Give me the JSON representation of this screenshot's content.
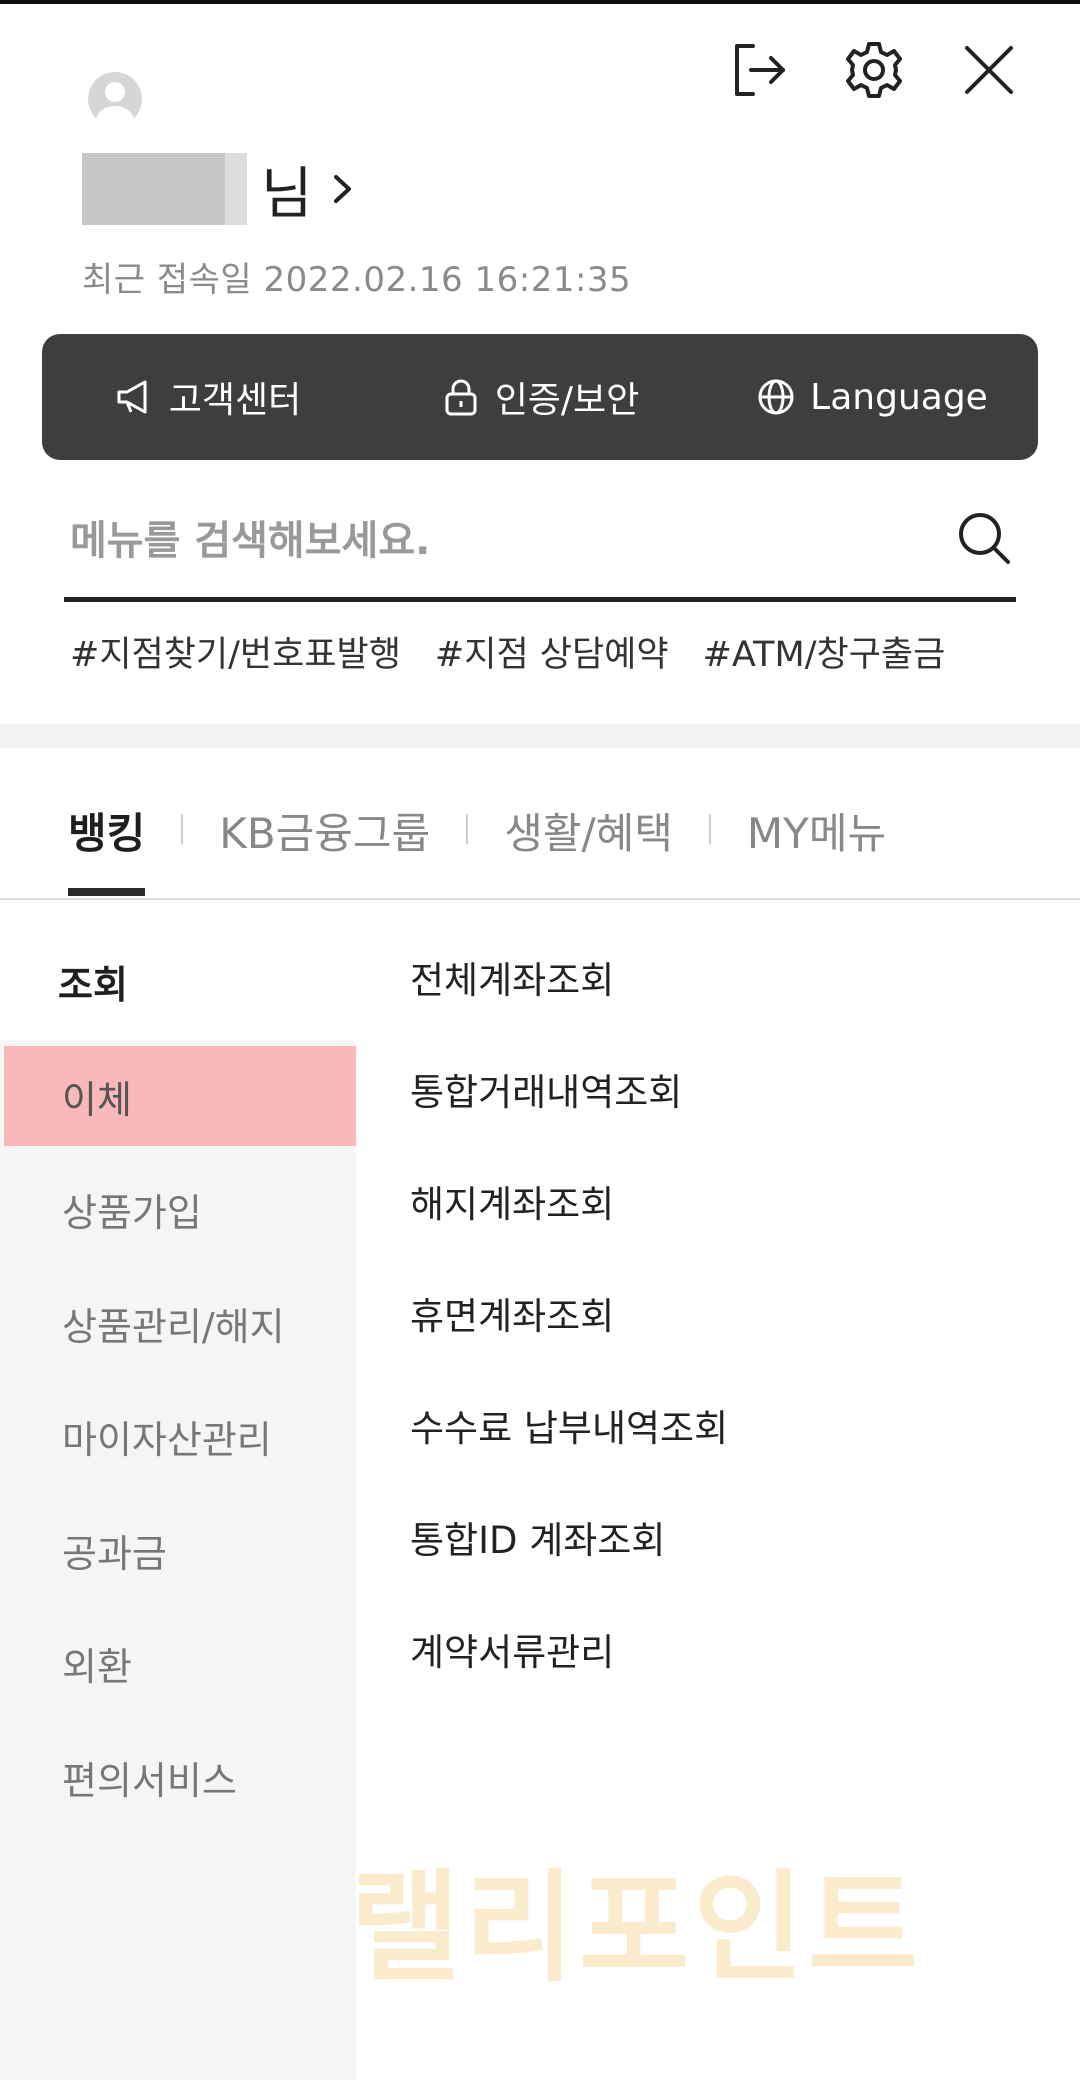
{
  "header": {
    "icons": [
      "logout-icon",
      "settings-icon",
      "close-icon"
    ]
  },
  "user": {
    "name_suffix": "님",
    "last_login": "최근 접속일 2022.02.16 16:21:35"
  },
  "quick_bar": {
    "items": [
      {
        "icon": "megaphone-icon",
        "label": "고객센터"
      },
      {
        "icon": "lock-icon",
        "label": "인증/보안"
      },
      {
        "icon": "globe-icon",
        "label": "Language"
      }
    ],
    "background": "#403e3c"
  },
  "search": {
    "placeholder": "메뉴를 검색해보세요.",
    "value": ""
  },
  "hashtags": [
    "#지점찾기/번호표발행",
    "#지점 상담예약",
    "#ATM/창구출금"
  ],
  "tabs": [
    {
      "label": "뱅킹",
      "active": true
    },
    {
      "label": "KB금융그룹",
      "active": false
    },
    {
      "label": "생활/혜택",
      "active": false
    },
    {
      "label": "MY메뉴",
      "active": false
    }
  ],
  "sidebar": {
    "items": [
      {
        "label": "조회",
        "state": "current"
      },
      {
        "label": "이체",
        "state": "selected"
      },
      {
        "label": "상품가입",
        "state": "normal"
      },
      {
        "label": "상품관리/해지",
        "state": "normal"
      },
      {
        "label": "마이자산관리",
        "state": "normal"
      },
      {
        "label": "공과금",
        "state": "normal"
      },
      {
        "label": "외환",
        "state": "normal"
      },
      {
        "label": "편의서비스",
        "state": "normal"
      }
    ],
    "selected_color": "#f9b8b9"
  },
  "submenu": {
    "items": [
      "전체계좌조회",
      "통합거래내역조회",
      "해지계좌조회",
      "휴면계좌조회",
      "수수료 납부내역조회",
      "통합ID 계좌조회",
      "계약서류관리"
    ]
  },
  "watermark": {
    "text": "랠리포인트"
  }
}
